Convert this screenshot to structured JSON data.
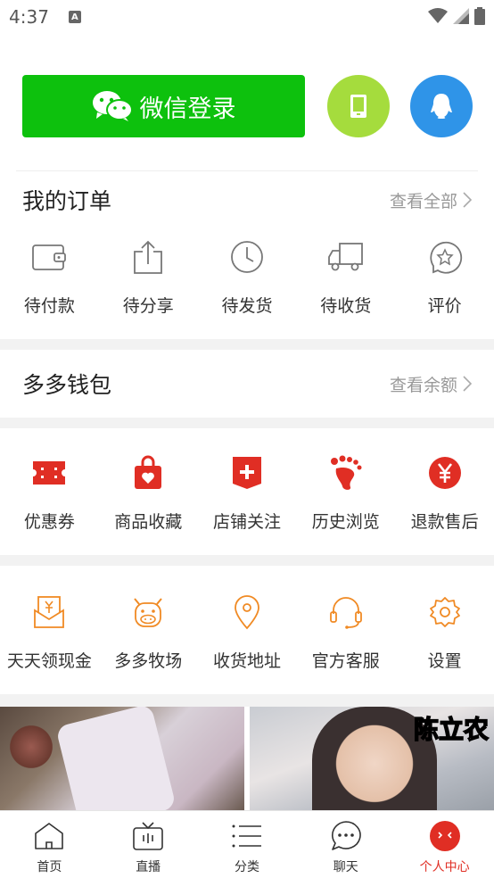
{
  "status_bar": {
    "time": "4:37",
    "badge": "A"
  },
  "login": {
    "wechat_label": "微信登录",
    "phone_icon": "phone-icon",
    "qq_icon": "qq-penguin-icon",
    "colors": {
      "wechat": "#0dc10d",
      "phone": "#a5dc3d",
      "qq": "#2f94e8"
    }
  },
  "orders": {
    "title": "我的订单",
    "more": "查看全部",
    "items": [
      {
        "label": "待付款",
        "icon": "wallet-icon"
      },
      {
        "label": "待分享",
        "icon": "share-icon"
      },
      {
        "label": "待发货",
        "icon": "clock-icon"
      },
      {
        "label": "待收货",
        "icon": "truck-icon"
      },
      {
        "label": "评价",
        "icon": "review-star-icon"
      }
    ]
  },
  "wallet": {
    "title": "多多钱包",
    "more": "查看余额"
  },
  "services": {
    "accent": "#e02e24",
    "items": [
      {
        "label": "优惠券",
        "icon": "coupon-icon"
      },
      {
        "label": "商品收藏",
        "icon": "bag-heart-icon"
      },
      {
        "label": "店铺关注",
        "icon": "store-plus-icon"
      },
      {
        "label": "历史浏览",
        "icon": "footprint-icon"
      },
      {
        "label": "退款售后",
        "icon": "yen-circle-icon"
      }
    ]
  },
  "tools": {
    "accent": "#f08a24",
    "items": [
      {
        "label": "天天领现金",
        "icon": "cash-envelope-icon"
      },
      {
        "label": "多多牧场",
        "icon": "cow-icon"
      },
      {
        "label": "收货地址",
        "icon": "location-pin-icon"
      },
      {
        "label": "官方客服",
        "icon": "headset-icon"
      },
      {
        "label": "设置",
        "icon": "gear-icon"
      }
    ]
  },
  "feed": {
    "caption_right": "陈立农"
  },
  "tabbar": {
    "items": [
      {
        "label": "首页",
        "icon": "home-icon"
      },
      {
        "label": "直播",
        "icon": "tv-icon"
      },
      {
        "label": "分类",
        "icon": "list-icon"
      },
      {
        "label": "聊天",
        "icon": "chat-icon"
      },
      {
        "label": "个人中心",
        "icon": "profile-icon",
        "active": true
      }
    ]
  }
}
